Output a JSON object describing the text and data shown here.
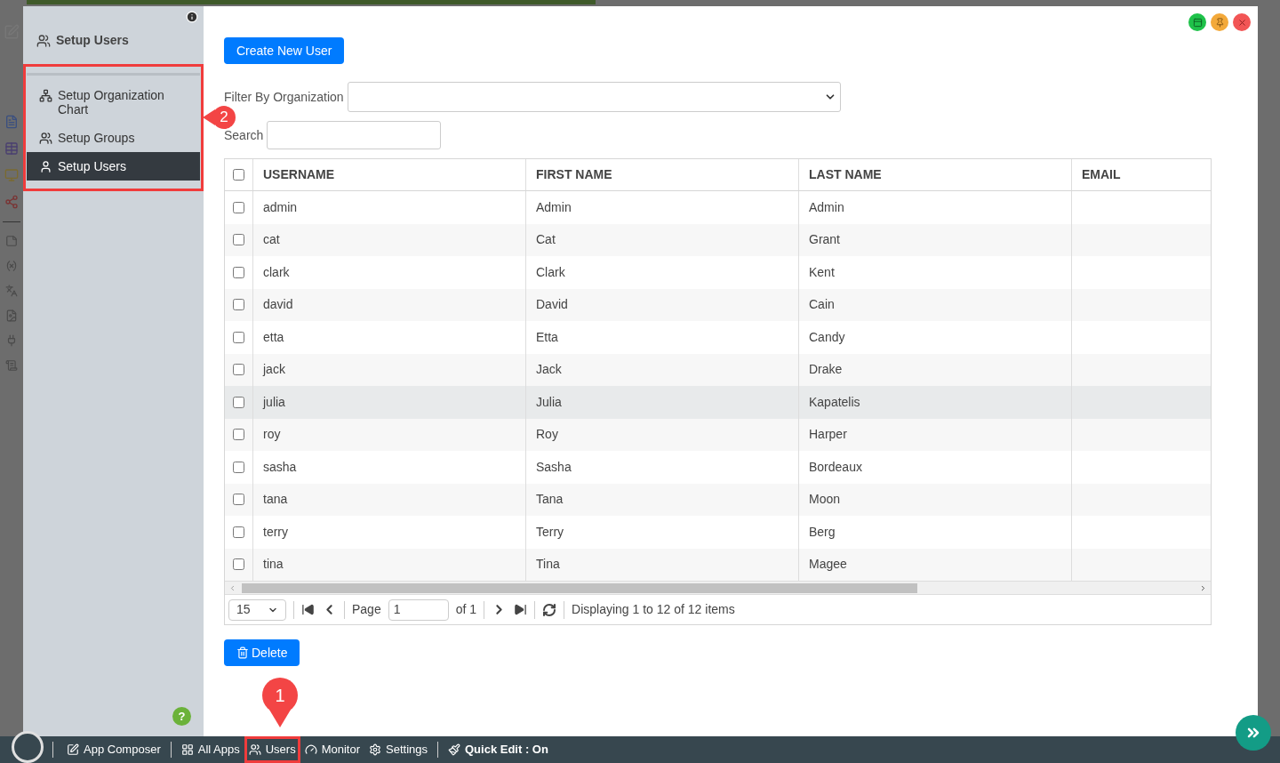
{
  "sidebar": {
    "title": "Setup Users",
    "items": [
      {
        "label": "Setup Organization Chart",
        "kind": "org",
        "selected": false
      },
      {
        "label": "Setup Groups",
        "kind": "groups",
        "selected": false
      },
      {
        "label": "Setup Users",
        "kind": "user",
        "selected": true
      }
    ]
  },
  "create_button": "Create New User",
  "filter": {
    "label": "Filter By Organization"
  },
  "search": {
    "label": "Search"
  },
  "help_icon": "?",
  "table": {
    "all_checked": false,
    "columns": [
      "USERNAME",
      "FIRST NAME",
      "LAST NAME",
      "EMAIL"
    ],
    "rows": [
      {
        "cells": [
          "admin",
          "Admin",
          "Admin"
        ],
        "checked": false,
        "highlighted": false
      },
      {
        "cells": [
          "cat",
          "Cat",
          "Grant"
        ],
        "checked": false,
        "highlighted": false
      },
      {
        "cells": [
          "clark",
          "Clark",
          "Kent"
        ],
        "checked": false,
        "highlighted": false
      },
      {
        "cells": [
          "david",
          "David",
          "Cain"
        ],
        "checked": false,
        "highlighted": false
      },
      {
        "cells": [
          "etta",
          "Etta",
          "Candy"
        ],
        "checked": false,
        "highlighted": false
      },
      {
        "cells": [
          "jack",
          "Jack",
          "Drake"
        ],
        "checked": false,
        "highlighted": false
      },
      {
        "cells": [
          "julia",
          "Julia",
          "Kapatelis"
        ],
        "checked": false,
        "highlighted": true
      },
      {
        "cells": [
          "roy",
          "Roy",
          "Harper"
        ],
        "checked": false,
        "highlighted": false
      },
      {
        "cells": [
          "sasha",
          "Sasha",
          "Bordeaux"
        ],
        "checked": false,
        "highlighted": false
      },
      {
        "cells": [
          "tana",
          "Tana",
          "Moon"
        ],
        "checked": false,
        "highlighted": false
      },
      {
        "cells": [
          "terry",
          "Terry",
          "Berg"
        ],
        "checked": false,
        "highlighted": false
      },
      {
        "cells": [
          "tina",
          "Tina",
          "Magee"
        ],
        "checked": false,
        "highlighted": false
      }
    ]
  },
  "pager": {
    "page_size": "15",
    "page_label": "Page",
    "page": "1",
    "of": "of 1",
    "status": "Displaying 1 to 12 of 12 items"
  },
  "delete_button": "Delete",
  "taskbar": [
    {
      "label": "App Composer",
      "kind": "edit",
      "highlighted": false
    },
    {
      "label": "All Apps",
      "kind": "grid",
      "highlighted": false
    },
    {
      "label": "Users",
      "kind": "users",
      "highlighted": true
    },
    {
      "label": "Monitor",
      "kind": "gauge",
      "highlighted": false
    },
    {
      "label": "Settings",
      "kind": "cogs",
      "highlighted": false
    },
    {
      "label": "Quick Edit : On",
      "kind": "brush",
      "highlighted": false
    }
  ],
  "callouts": [
    "1",
    "2"
  ]
}
